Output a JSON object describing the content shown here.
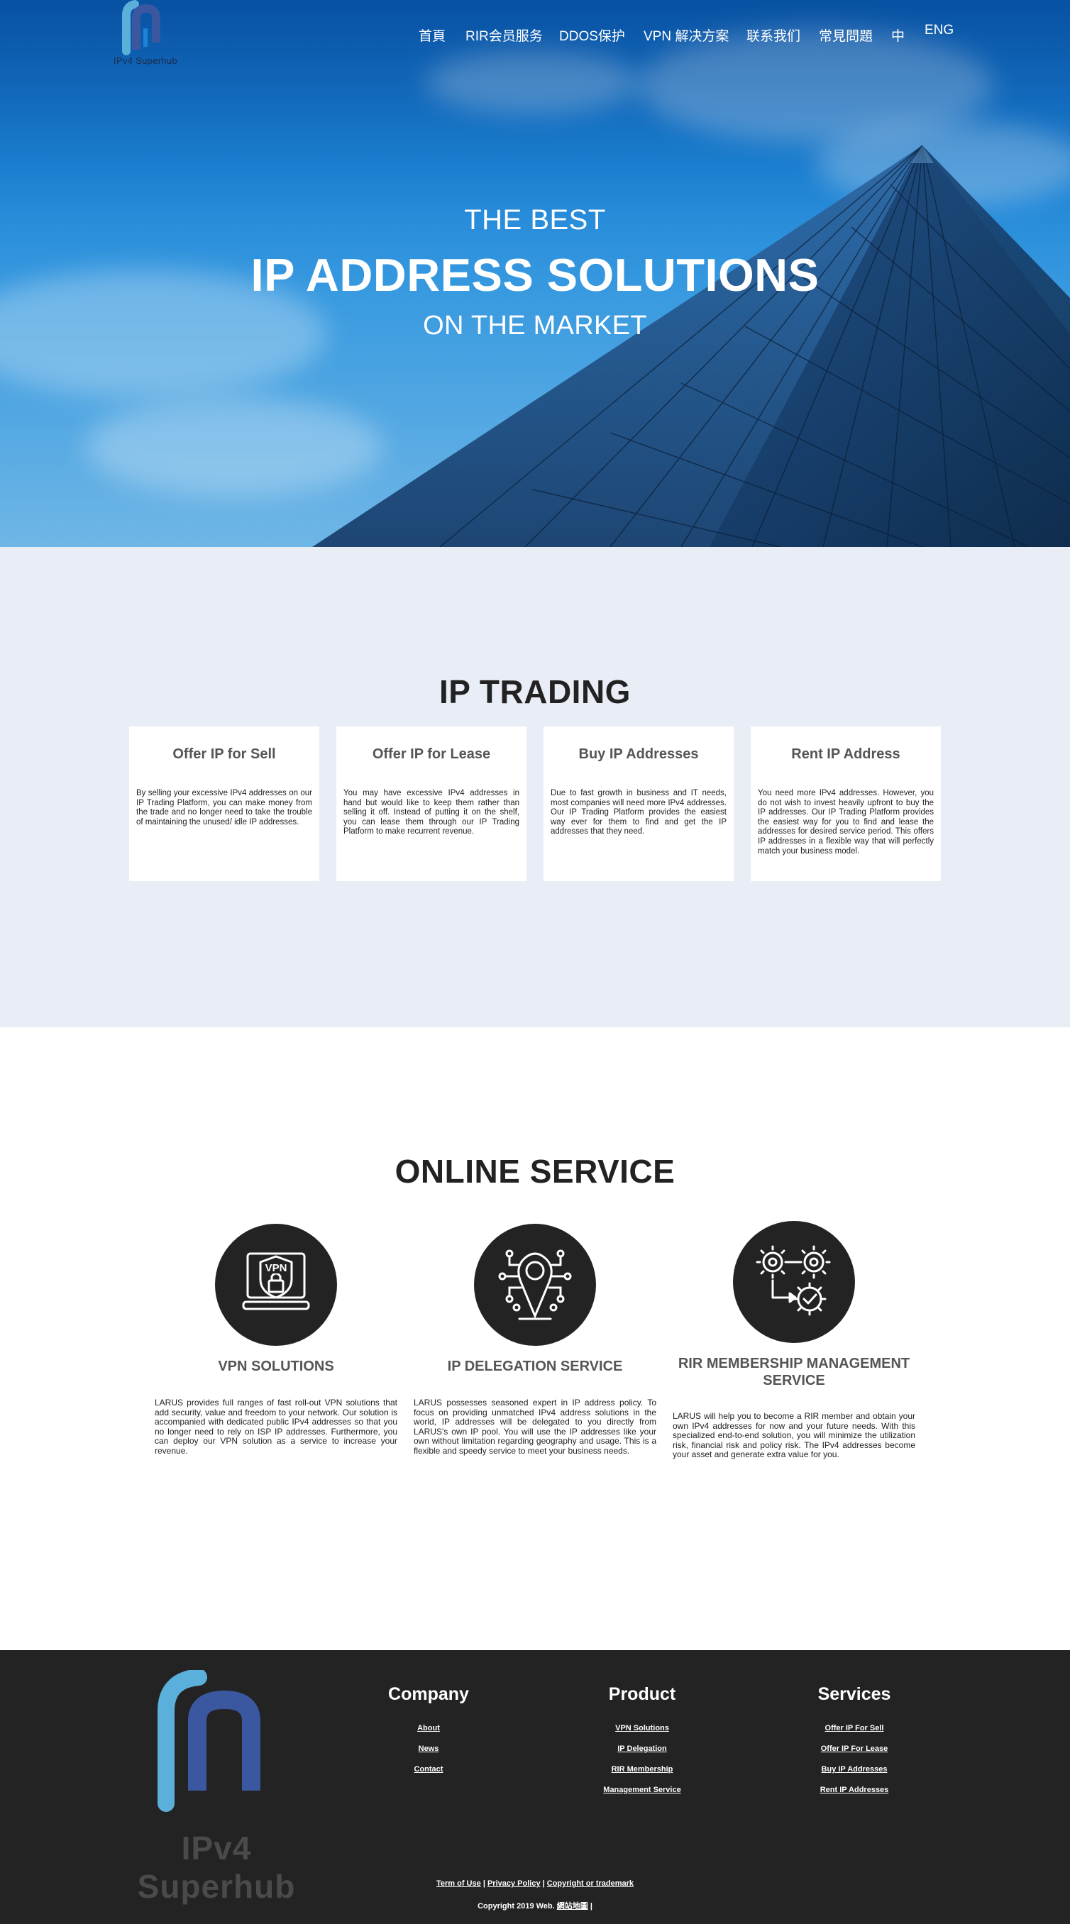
{
  "brand": {
    "name": "IPv4 Superhub",
    "logo_color_top": "#5ab0da",
    "logo_color_main": "#3a57a0"
  },
  "nav": {
    "items": [
      {
        "label": "首頁"
      },
      {
        "label": "RIR会员服务"
      },
      {
        "label": "DDOS保护"
      },
      {
        "label": "VPN 解决方案"
      },
      {
        "label": "联系我们"
      },
      {
        "label": "常見問題"
      },
      {
        "label": "中"
      },
      {
        "label": "ENG"
      }
    ]
  },
  "hero": {
    "line1": "THE BEST",
    "line2": "IP ADDRESS SOLUTIONS",
    "line3": "ON THE MARKET"
  },
  "trading": {
    "title": "IP TRADING",
    "cards": [
      {
        "title": "Offer IP for Sell",
        "text": "By selling your excessive IPv4 addresses on our IP Trading Platform, you can make money from the trade and no longer need to take the trouble of maintaining the unused/ idle IP addresses."
      },
      {
        "title": "Offer IP for Lease",
        "text": "You may have excessive IPv4 addresses in hand but would like to keep them rather than selling it off. Instead of putting it on the shelf, you can lease them through our IP Trading Platform to make recurrent revenue."
      },
      {
        "title": "Buy IP Addresses",
        "text": "Due to fast growth in business and IT needs, most companies will need more IPv4 addresses. Our IP Trading Platform provides the easiest way ever for them to find and get the IP addresses that they need."
      },
      {
        "title": "Rent IP Address",
        "text": "You need more IPv4 addresses. However, you do not wish to invest heavily upfront to buy the IP addresses. Our IP Trading Platform provides the easiest way for you to find and lease the addresses for desired service period. This offers IP addresses in a flexible way that will perfectly match your business model."
      }
    ]
  },
  "online": {
    "title": "ONLINE SERVICE",
    "services": [
      {
        "title": "VPN SOLUTIONS",
        "icon": "vpn-laptop-icon",
        "icon_text": "VPN",
        "text": "LARUS provides full ranges of fast roll-out VPN solutions that add security, value and freedom to your network. Our solution is accompanied with dedicated public IPv4 addresses so that you no longer need to rely on ISP IP addresses. Furthermore, you can deploy our VPN solution as a service to increase your revenue."
      },
      {
        "title": "IP DELEGATION SERVICE",
        "icon": "location-circuit-icon",
        "text": "LARUS possesses seasoned expert in IP address policy. To focus on providing unmatched IPv4 address solutions in the world, IP addresses will be delegated to you directly from LARUS's own IP pool. You will use the IP addresses like your own without limitation regarding geography and usage. This is a flexible and speedy service to meet your business needs."
      },
      {
        "title": "RIR MEMBERSHIP MANAGEMENT SERVICE",
        "icon": "gears-check-icon",
        "text": "LARUS will help you to become a RIR member and obtain your own IPv4 addresses for now and your future needs. With this specialized end-to-end solution, you will minimize the utilization risk, financial risk and policy risk. The IPv4 addresses become your asset and generate extra value for you."
      }
    ]
  },
  "footer": {
    "logo_text": "IPv4 Superhub",
    "columns": [
      {
        "title": "Company",
        "links": [
          "About",
          "News",
          "Contact"
        ]
      },
      {
        "title": "Product",
        "links": [
          "VPN Solutions",
          "IP Delegation",
          "RIR Membership",
          "Management Service"
        ]
      },
      {
        "title": "Services",
        "links": [
          "Offer IP For Sell",
          "Offer IP For Lease",
          "Buy IP Addresses",
          "Rent IP Addresses"
        ]
      }
    ],
    "legal": {
      "terms": "Term of Use",
      "privacy": "Privacy Policy",
      "copyright_link": "Copyright or trademark",
      "sep": "|"
    },
    "copyright": {
      "prefix": "Copyright 2019 Web.",
      "sitemap": "網站地圖",
      "suffix": "|"
    }
  }
}
